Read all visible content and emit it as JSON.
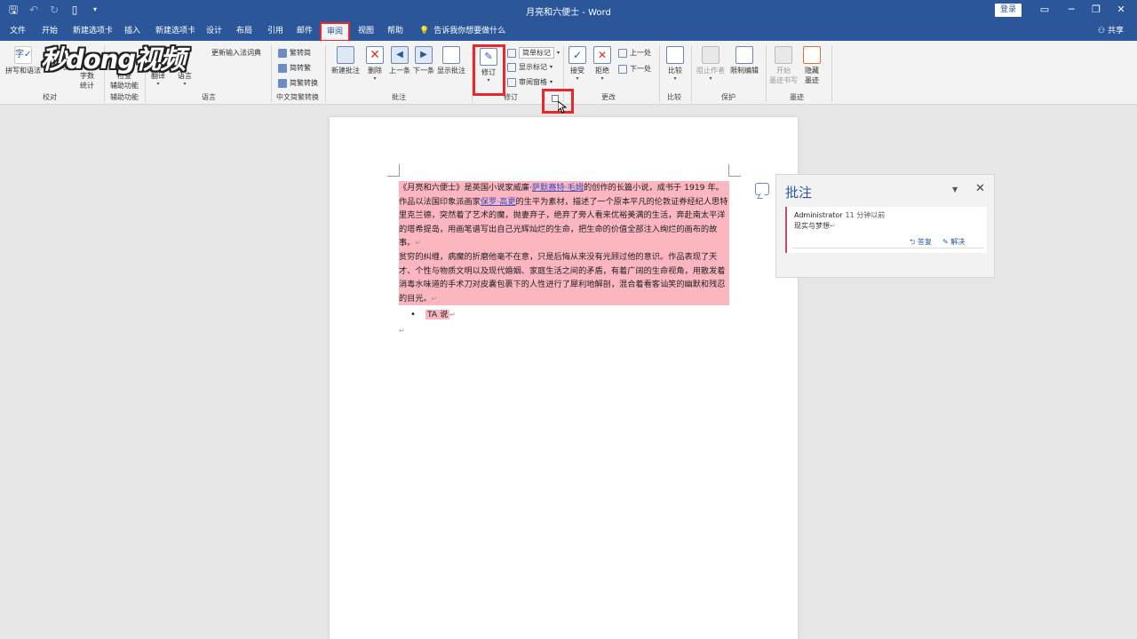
{
  "window": {
    "title": "月亮和六便士 - Word",
    "login": "登录",
    "controls": [
      "▭",
      "─",
      "❐",
      "✕"
    ]
  },
  "qat": [
    "save-icon",
    "undo-icon",
    "redo-icon",
    "new-doc-icon",
    "customize-icon"
  ],
  "tabs": [
    "文件",
    "开始",
    "新建选项卡",
    "插入",
    "新建选项卡",
    "设计",
    "布局",
    "引用",
    "邮件",
    "审阅",
    "视图",
    "帮助"
  ],
  "active_tab": "审阅",
  "tell_me": "告诉我你想要做什么",
  "share": "共享",
  "ribbon": {
    "proofing": {
      "label": "校对",
      "spelling": "拼写和语法",
      "thesaurus": "同义词库",
      "wordcount_1": "字数",
      "wordcount_2": "统计"
    },
    "accessibility": {
      "label": "辅助功能",
      "check": "检查",
      "check2": "辅助功能"
    },
    "language": {
      "label": "语言",
      "translate": "翻译",
      "language": "语言",
      "update_ime": "更新输入法词典"
    },
    "chinese": {
      "label": "中文简繁转换",
      "t2s": "繁转简",
      "s2t": "简转繁",
      "convert": "简繁转换"
    },
    "comments": {
      "label": "批注",
      "new": "新建批注",
      "delete": "删除",
      "prev": "上一条",
      "next": "下一条",
      "show": "显示批注"
    },
    "tracking": {
      "label": "修订",
      "track": "修订",
      "simple_markup": "简单标记",
      "show_markup": "显示标记",
      "review_pane": "审阅窗格"
    },
    "changes": {
      "label": "更改",
      "accept": "接受",
      "reject": "拒绝",
      "prev": "上一处",
      "next": "下一处"
    },
    "compare": {
      "label": "比较",
      "compare": "比较"
    },
    "protect": {
      "label": "保护",
      "block": "阻止作者",
      "restrict": "限制编辑"
    },
    "ink": {
      "label": "墨迹",
      "start_1": "开始",
      "start_2": "墨迹书写",
      "hide_1": "隐藏",
      "hide_2": "墨迹"
    }
  },
  "watermark": "秒dong视频",
  "document": {
    "para1_a": "《月亮和六便士》是英国小说家威廉·",
    "para1_link1": "萨默赛特·毛姆",
    "para1_b": "的创作的长篇小说，成书于 1919 年。作品以法国印象派画家",
    "para1_link2": "保罗·高更",
    "para1_c": "的生平为素材，描述了一个原本平凡的伦敦证券经纪人思特里克兰德，突然着了艺术的魔，抛妻弃子，绝弃了旁人看来优裕美满的生活，奔赴南太平洋的塔希提岛，用画笔谱写出自己光辉灿烂的生命，把生命的价值全部注入绚烂的画布的故事。",
    "para2": "贫穷的纠缠，病魔的折磨他毫不在意，只是后悔从来没有光顾过他的意识。作品表现了天才、个性与物质文明以及现代婚姻、家庭生活之间的矛盾，有着广阔的生命视角，用散发着消毒水味道的手术刀对皮囊包裹下的人性进行了犀利地解剖，混合着看客讪笑的幽默和残忍的目光。",
    "bullet": "TA 说"
  },
  "comments_pane": {
    "title": "批注",
    "author": "Administrator",
    "time": "11 分钟以前",
    "text": "现实与梦想",
    "reply": "答复",
    "resolve": "解决"
  }
}
